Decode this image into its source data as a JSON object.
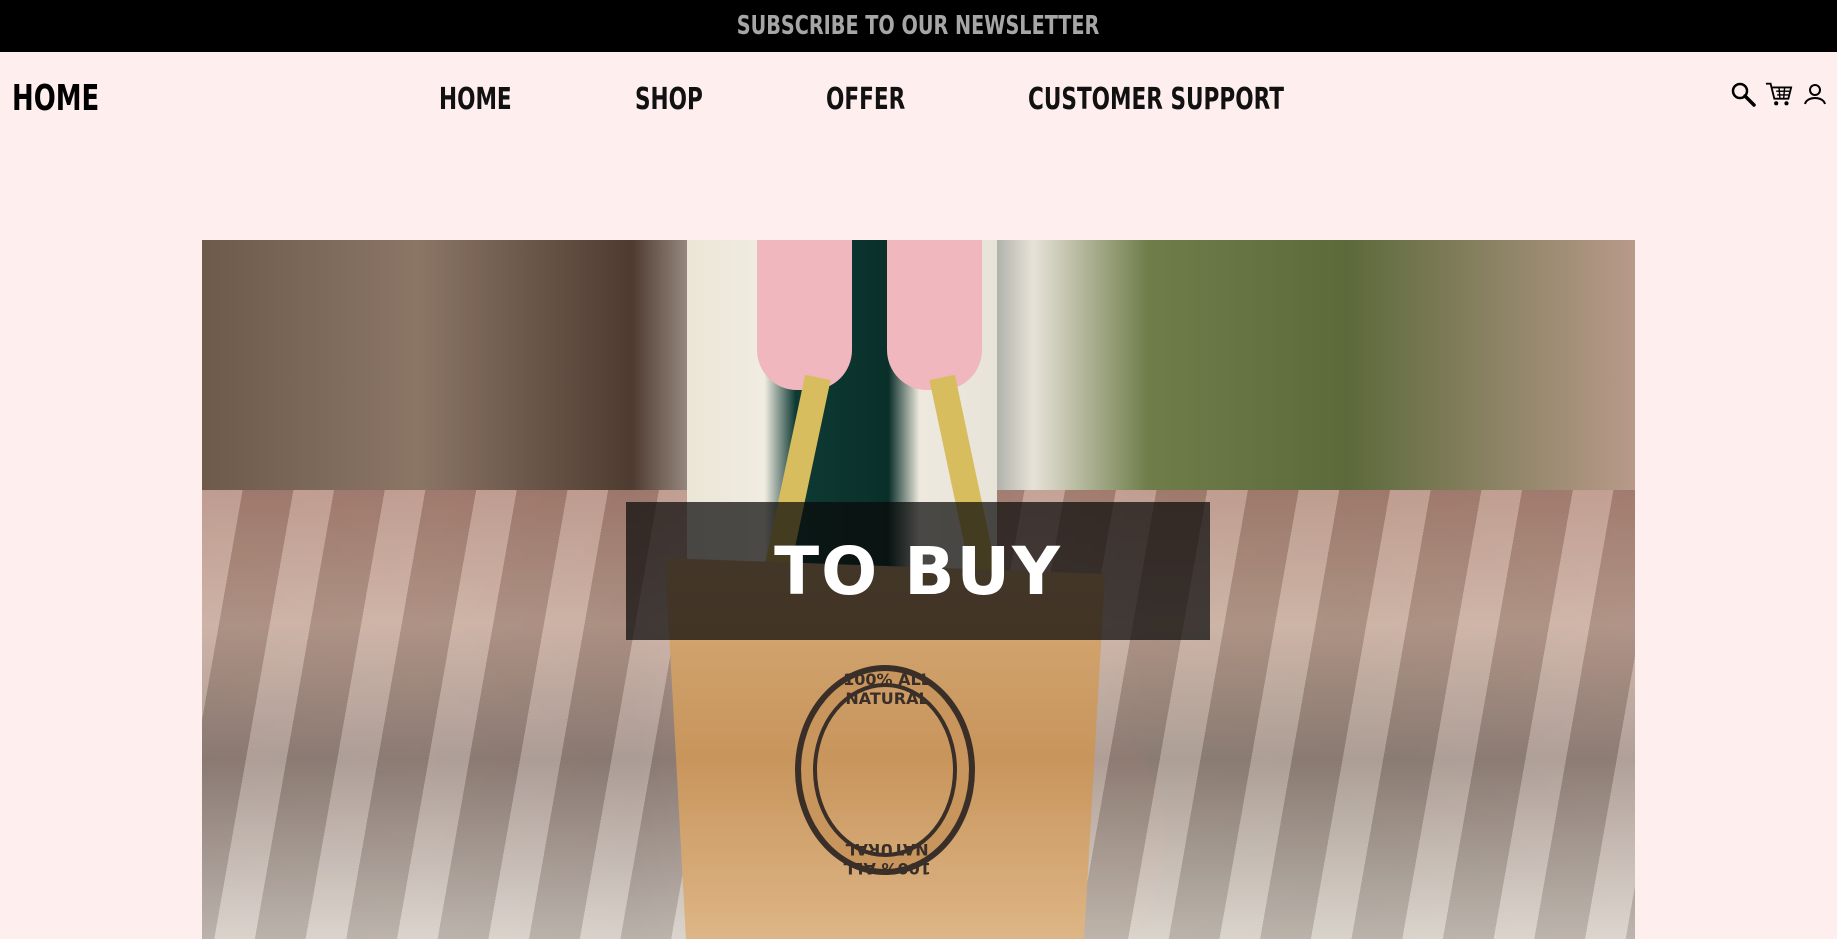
{
  "topbar": {
    "newsletter_label": "SUBSCRIBE TO OUR NEWSLETTER"
  },
  "brand": "HOME",
  "nav": {
    "items": [
      {
        "label": "HOME"
      },
      {
        "label": "SHOP"
      },
      {
        "label": "OFFER"
      },
      {
        "label": "CUSTOMER SUPPORT"
      }
    ]
  },
  "header_icons": [
    "search-icon",
    "cart-icon",
    "account-icon"
  ],
  "hero": {
    "title": "TO BUY",
    "bag_seal_text": "100% ALL NATURAL",
    "overlay_color": "#0a0a0a"
  },
  "colors": {
    "page_bg": "#ffeeee",
    "topbar_bg": "#000000",
    "topbar_text": "#a6a6a6"
  }
}
